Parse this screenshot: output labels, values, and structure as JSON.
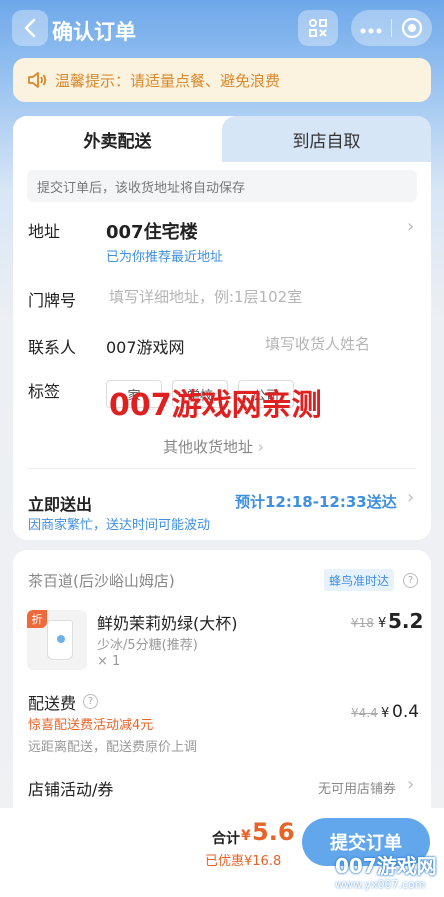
{
  "header": {
    "title": "确认订单",
    "more_icon": "ellipsis-icon",
    "close_icon": "target-icon"
  },
  "tip": {
    "text": "温馨提示：请适量点餐、避免浪费"
  },
  "tabs": [
    {
      "label": "外卖配送"
    },
    {
      "label": "到店自取"
    }
  ],
  "address": {
    "notice": "提交订单后，该收货地址将自动保存",
    "label": "地址",
    "name": "007住宅楼",
    "hint": "已为你推荐最近地址",
    "door_label": "门牌号",
    "door_placeholder": "填写详细地址，例:1层102室",
    "contact_label": "联系人",
    "contact_name": "007游戏网",
    "contact_placeholder": "填写收货人姓名",
    "tag_label": "标签",
    "tags": [
      "家",
      "学校",
      "公司"
    ],
    "watermark": "007游戏网亲测",
    "other_label": "其他收货地址"
  },
  "delivery": {
    "label": "立即送出",
    "eta": "预计12:18-12:33送达",
    "note": "因商家繁忙，送达时间可能波动"
  },
  "order": {
    "store": "茶百道(后沙峪山姆店)",
    "badge": "蜂鸟准时达",
    "product": {
      "discount_badge": "折",
      "name": "鲜奶茉莉奶绿(大杯)",
      "spec": "少冰/5分糖(推荐)",
      "qty": "× 1",
      "orig_price": "¥18",
      "currency": "¥",
      "price": "5.2"
    },
    "fee": {
      "label": "配送费",
      "promo": "惊喜配送费活动减4元",
      "note": "远距离配送，配送费原价上调",
      "orig": "¥4.4",
      "currency": "¥",
      "value": "0.4"
    },
    "promo": {
      "label": "店铺活动/券",
      "value": "无可用店铺券"
    }
  },
  "bottom": {
    "total_label": "合计",
    "currency": "¥",
    "total": "5.6",
    "saved": "已优惠¥16.8",
    "submit": "提交订单",
    "watermark": "007游戏网",
    "url": "www.yx007.com"
  }
}
